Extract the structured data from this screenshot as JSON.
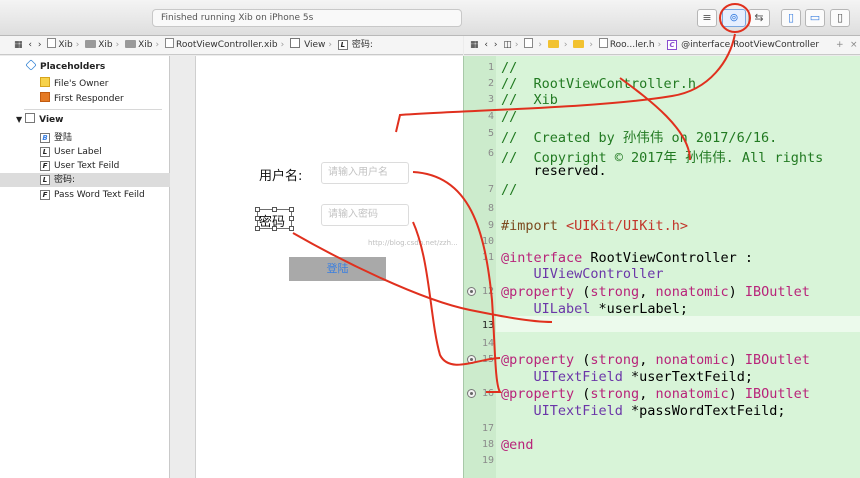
{
  "toolbar": {
    "activity_text": "Finished running Xib on iPhone 5s",
    "buttons": [
      "standard-editor",
      "assistant-editor",
      "version-editor",
      "navigator-toggle",
      "debug-toggle",
      "utilities-toggle"
    ]
  },
  "left_jumpbar": {
    "crumbs": [
      "Xib",
      "Xib",
      "Xib",
      "RootViewController.xib",
      "View",
      "密码:"
    ]
  },
  "right_jumpbar": {
    "crumbs": [
      "Roo...ler.h",
      "@interface RootViewController"
    ],
    "add_label": "+",
    "close_label": "×"
  },
  "outline": {
    "placeholders_label": "Placeholders",
    "files_owner": "File's Owner",
    "first_responder": "First Responder",
    "view_label": "View",
    "children": [
      {
        "badge": "B",
        "label": "登陆"
      },
      {
        "badge": "L",
        "label": "User Label"
      },
      {
        "badge": "F",
        "label": "User Text Feild"
      },
      {
        "badge": "L",
        "label": "密码:"
      },
      {
        "badge": "F",
        "label": "Pass Word Text Feild"
      }
    ]
  },
  "canvas": {
    "username_label": "用户名:",
    "username_placeholder": "请输入用户名",
    "password_label": "密码",
    "password_placeholder": "请输入密码",
    "login_button": "登陆",
    "watermark": "http://blog.csdn.net/zzh..."
  },
  "editor": {
    "line_numbers": [
      "1",
      "2",
      "3",
      "4",
      "5",
      "6",
      "",
      "7",
      "8",
      "9",
      "10",
      "11",
      "",
      "12",
      "",
      "13",
      "14",
      "15",
      "",
      "16",
      "",
      "17",
      "18",
      "19"
    ],
    "lines": [
      {
        "n": "1",
        "text": "//"
      },
      {
        "n": "2",
        "text": "//  RootViewController.h"
      },
      {
        "n": "3",
        "text": "//  Xib"
      },
      {
        "n": "4",
        "text": "//"
      },
      {
        "n": "5",
        "text": "//  Created by 孙伟伟 on 2017/6/16."
      },
      {
        "n": "6",
        "text": "//  Copyright © 2017年 孙伟伟. All rights"
      },
      {
        "n": "",
        "text": "    reserved."
      },
      {
        "n": "7",
        "text": "//"
      },
      {
        "n": "8",
        "text": ""
      },
      {
        "n": "9",
        "text": "#import <UIKit/UIKit.h>"
      },
      {
        "n": "10",
        "text": ""
      },
      {
        "n": "11",
        "text": "@interface RootViewController :"
      },
      {
        "n": "",
        "text": "    UIViewController"
      },
      {
        "n": "12",
        "text": "@property (strong, nonatomic) IBOutlet"
      },
      {
        "n": "",
        "text": "    UILabel *userLabel;"
      },
      {
        "n": "13",
        "text": ""
      },
      {
        "n": "14",
        "text": ""
      },
      {
        "n": "15",
        "text": "@property (strong, nonatomic) IBOutlet"
      },
      {
        "n": "",
        "text": "    UITextField *userTextFeild;"
      },
      {
        "n": "16",
        "text": "@property (strong, nonatomic) IBOutlet"
      },
      {
        "n": "",
        "text": "    UITextField *passWordTextFeild;"
      },
      {
        "n": "17",
        "text": ""
      },
      {
        "n": "18",
        "text": "@end"
      },
      {
        "n": "19",
        "text": ""
      }
    ]
  },
  "colors": {
    "editor_bg": "#d8f4d8",
    "comment": "#227a22",
    "keyword": "#b8247a",
    "annotation": "#e0301e"
  }
}
